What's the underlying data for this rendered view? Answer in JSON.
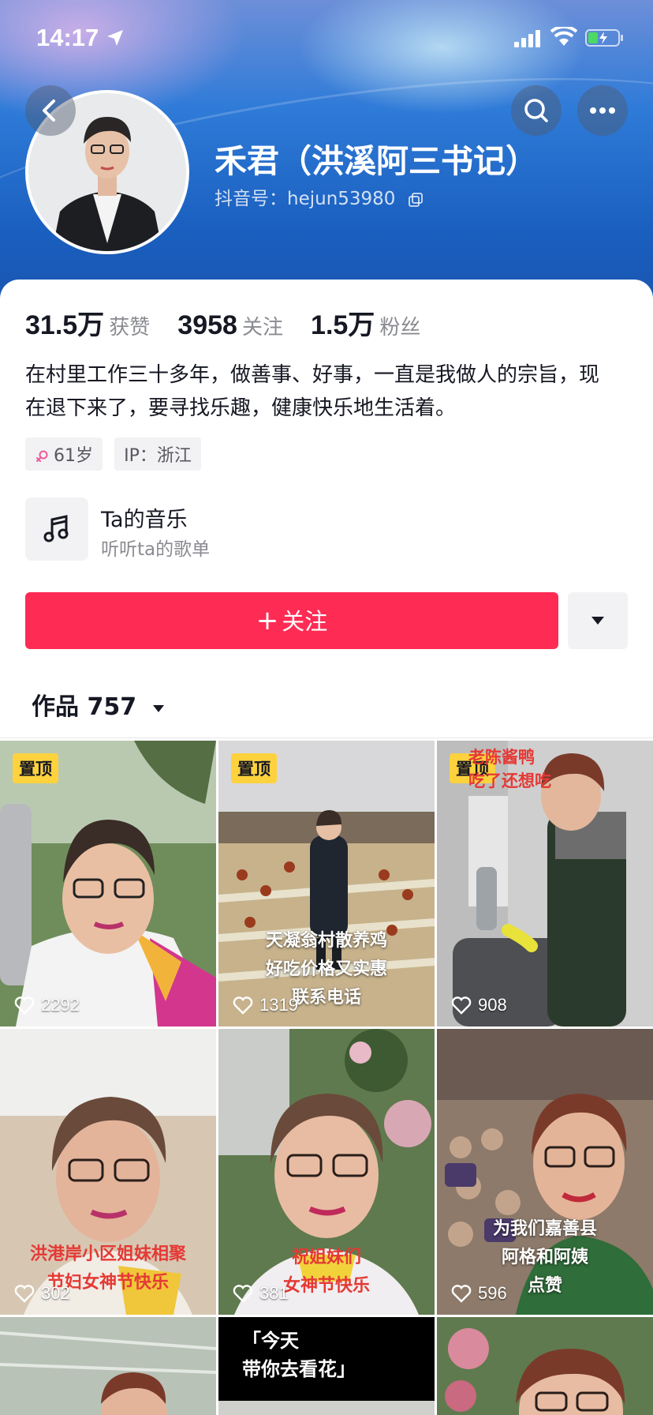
{
  "status_bar": {
    "time": "14:17"
  },
  "profile": {
    "nickname": "禾君（洪溪阿三书记）",
    "douyin_id": "抖音号：hejun53980",
    "stats": [
      {
        "value": "31.5万",
        "label": "获赞"
      },
      {
        "value": "3958",
        "label": "关注"
      },
      {
        "value": "1.5万",
        "label": "粉丝"
      }
    ],
    "bio": "在村里工作三十多年，做善事、好事，一直是我做人的宗旨，现在退下来了，要寻找乐趣，健康快乐地生活着。",
    "tags": {
      "age": "61岁",
      "ip": "IP：浙江"
    }
  },
  "music": {
    "title": "Ta的音乐",
    "subtitle": "听听ta的歌单"
  },
  "actions": {
    "follow_label": "关注",
    "follow_plus": "+"
  },
  "works": {
    "tab_label": "作品 757"
  },
  "videos": [
    {
      "pinned": "置顶",
      "likes": "2292",
      "caption": ""
    },
    {
      "pinned": "置顶",
      "likes": "1319",
      "caption": "天凝翁村散养鸡 好吃价格又实惠 联系电话"
    },
    {
      "pinned": "置顶",
      "likes": "908",
      "caption": "老陈酱鸭 吃了还想吃"
    },
    {
      "pinned": "",
      "likes": "302",
      "caption": "洪港岸小区姐妹相聚 节妇女神节快乐"
    },
    {
      "pinned": "",
      "likes": "381",
      "caption": "祝姐妹们 女神节快乐"
    },
    {
      "pinned": "",
      "likes": "596",
      "caption": "为我们嘉善县 阿格和阿姨 点赞"
    },
    {
      "pinned": "",
      "likes": "",
      "caption": ""
    },
    {
      "pinned": "",
      "likes": "",
      "caption": "「今天 带你去看花」"
    },
    {
      "pinned": "",
      "likes": "",
      "caption": ""
    }
  ],
  "colors": {
    "accent": "#fe2c55",
    "pin": "#fdd23d",
    "banner": "#2f7bd8"
  }
}
